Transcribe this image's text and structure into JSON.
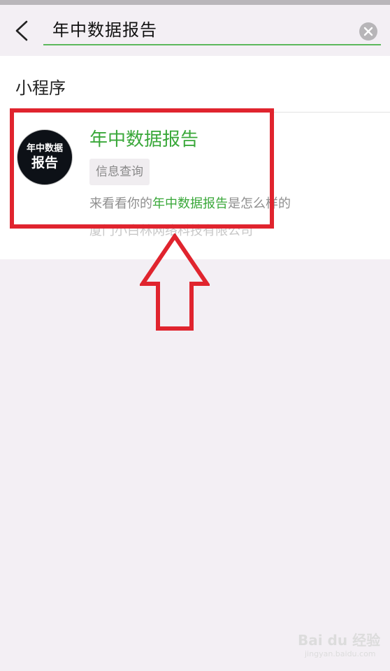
{
  "search": {
    "query": "年中数据报告"
  },
  "icons": {
    "back": "chevron-left-icon",
    "clear": "clear-circle-icon"
  },
  "section": {
    "title": "小程序"
  },
  "result": {
    "avatar_line1": "年中数据",
    "avatar_line2": "报告",
    "title": "年中数据报告",
    "tag": "信息查询",
    "desc_prefix": "来看看你的",
    "desc_highlight": "年中数据报告",
    "desc_suffix": "是怎么样的",
    "company": "厦门小白林网络科技有限公司"
  },
  "watermark": {
    "brand": "Bai du 经验",
    "sub": "jingyan.baidu.com"
  },
  "colors": {
    "accent_green": "#3aa83a",
    "annotation_red": "#e0242e",
    "background": "#f3eff4"
  }
}
